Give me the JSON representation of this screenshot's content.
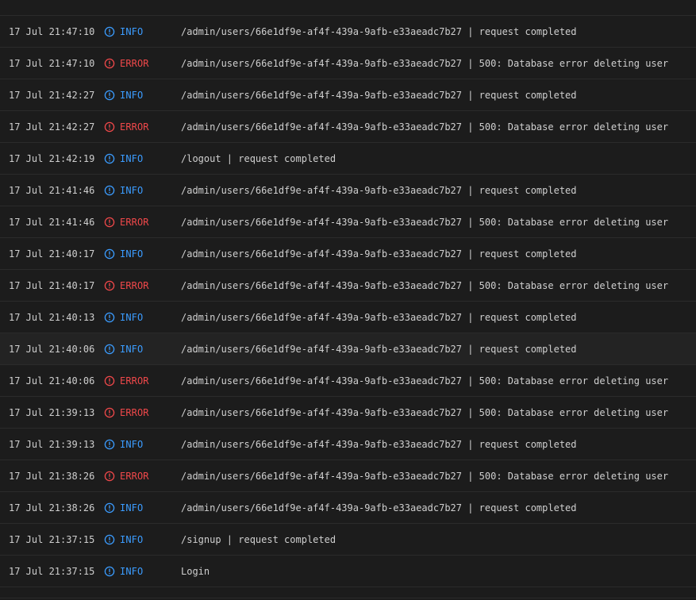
{
  "colors": {
    "background": "#1c1c1c",
    "row_hover": "#232323",
    "divider": "#2b2b2b",
    "info": "#3b9cff",
    "error": "#f0484a",
    "text": "#cfcfcf"
  },
  "rows": [
    {
      "time": "17 Jul 21:47:10",
      "level": "INFO",
      "icon": "info-circle-icon",
      "message": "/admin/users/66e1df9e-af4f-439a-9afb-e33aeadc7b27 | request completed"
    },
    {
      "time": "17 Jul 21:47:10",
      "level": "ERROR",
      "icon": "error-circle-icon",
      "message": "/admin/users/66e1df9e-af4f-439a-9afb-e33aeadc7b27 | 500: Database error deleting user"
    },
    {
      "time": "17 Jul 21:42:27",
      "level": "INFO",
      "icon": "info-circle-icon",
      "message": "/admin/users/66e1df9e-af4f-439a-9afb-e33aeadc7b27 | request completed"
    },
    {
      "time": "17 Jul 21:42:27",
      "level": "ERROR",
      "icon": "error-circle-icon",
      "message": "/admin/users/66e1df9e-af4f-439a-9afb-e33aeadc7b27 | 500: Database error deleting user"
    },
    {
      "time": "17 Jul 21:42:19",
      "level": "INFO",
      "icon": "info-circle-icon",
      "message": "/logout | request completed"
    },
    {
      "time": "17 Jul 21:41:46",
      "level": "INFO",
      "icon": "info-circle-icon",
      "message": "/admin/users/66e1df9e-af4f-439a-9afb-e33aeadc7b27 | request completed"
    },
    {
      "time": "17 Jul 21:41:46",
      "level": "ERROR",
      "icon": "error-circle-icon",
      "message": "/admin/users/66e1df9e-af4f-439a-9afb-e33aeadc7b27 | 500: Database error deleting user"
    },
    {
      "time": "17 Jul 21:40:17",
      "level": "INFO",
      "icon": "info-circle-icon",
      "message": "/admin/users/66e1df9e-af4f-439a-9afb-e33aeadc7b27 | request completed"
    },
    {
      "time": "17 Jul 21:40:17",
      "level": "ERROR",
      "icon": "error-circle-icon",
      "message": "/admin/users/66e1df9e-af4f-439a-9afb-e33aeadc7b27 | 500: Database error deleting user"
    },
    {
      "time": "17 Jul 21:40:13",
      "level": "INFO",
      "icon": "info-circle-icon",
      "message": "/admin/users/66e1df9e-af4f-439a-9afb-e33aeadc7b27 | request completed"
    },
    {
      "time": "17 Jul 21:40:06",
      "level": "INFO",
      "icon": "info-circle-icon",
      "message": "/admin/users/66e1df9e-af4f-439a-9afb-e33aeadc7b27 | request completed"
    },
    {
      "time": "17 Jul 21:40:06",
      "level": "ERROR",
      "icon": "error-circle-icon",
      "message": "/admin/users/66e1df9e-af4f-439a-9afb-e33aeadc7b27 | 500: Database error deleting user"
    },
    {
      "time": "17 Jul 21:39:13",
      "level": "ERROR",
      "icon": "error-circle-icon",
      "message": "/admin/users/66e1df9e-af4f-439a-9afb-e33aeadc7b27 | 500: Database error deleting user"
    },
    {
      "time": "17 Jul 21:39:13",
      "level": "INFO",
      "icon": "info-circle-icon",
      "message": "/admin/users/66e1df9e-af4f-439a-9afb-e33aeadc7b27 | request completed"
    },
    {
      "time": "17 Jul 21:38:26",
      "level": "ERROR",
      "icon": "error-circle-icon",
      "message": "/admin/users/66e1df9e-af4f-439a-9afb-e33aeadc7b27 | 500: Database error deleting user"
    },
    {
      "time": "17 Jul 21:38:26",
      "level": "INFO",
      "icon": "info-circle-icon",
      "message": "/admin/users/66e1df9e-af4f-439a-9afb-e33aeadc7b27 | request completed"
    },
    {
      "time": "17 Jul 21:37:15",
      "level": "INFO",
      "icon": "info-circle-icon",
      "message": "/signup | request completed"
    },
    {
      "time": "17 Jul 21:37:15",
      "level": "INFO",
      "icon": "info-circle-icon",
      "message": "Login"
    }
  ]
}
